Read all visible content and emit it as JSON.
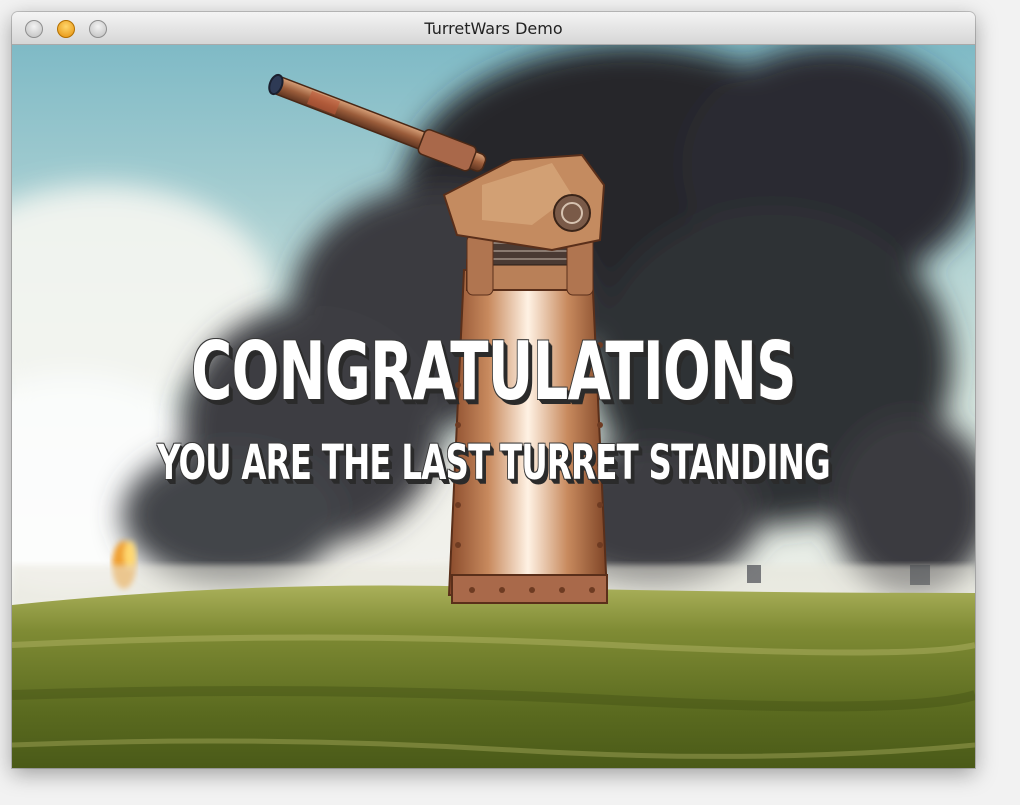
{
  "window": {
    "title": "TurretWars Demo"
  },
  "game": {
    "headline": "CONGRATULATIONS",
    "subheadline": "YOU ARE THE LAST TURRET STANDING"
  },
  "colors": {
    "sky": "#8cc4cf",
    "smoke": "#2b2b30",
    "grass": "#7d8a2e",
    "turret": "#c07a4c",
    "text": "#ffffff"
  }
}
